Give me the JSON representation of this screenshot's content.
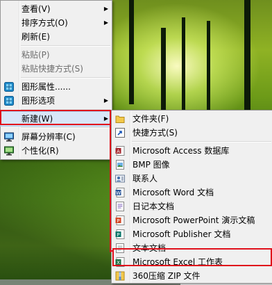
{
  "context_menu": {
    "items": [
      {
        "label": "查看(V)",
        "disabled": false,
        "arrow": "▶"
      },
      {
        "label": "排序方式(O)",
        "disabled": false,
        "arrow": "▶"
      },
      {
        "label": "刷新(E)",
        "disabled": false
      },
      {
        "label": "粘贴(P)",
        "disabled": true
      },
      {
        "label": "粘贴快捷方式(S)",
        "disabled": true
      },
      {
        "label": "图形属性......",
        "icon": "graphics-properties-icon"
      },
      {
        "label": "图形选项",
        "icon": "graphics-options-icon",
        "arrow": "▶"
      },
      {
        "label": "新建(W)",
        "arrow": "▶",
        "highlighted": true
      },
      {
        "label": "屏幕分辨率(C)",
        "icon": "screen-resolution-icon"
      },
      {
        "label": "个性化(R)",
        "icon": "personalize-icon"
      }
    ]
  },
  "new_submenu": {
    "items": [
      {
        "label": "文件夹(F)",
        "icon": "folder-icon"
      },
      {
        "label": "快捷方式(S)",
        "icon": "shortcut-icon"
      },
      {
        "label": "Microsoft Access 数据库",
        "icon": "access-icon"
      },
      {
        "label": "BMP 图像",
        "icon": "bmp-icon"
      },
      {
        "label": "联系人",
        "icon": "contact-icon"
      },
      {
        "label": "Microsoft Word 文档",
        "icon": "word-icon"
      },
      {
        "label": "日记本文档",
        "icon": "journal-icon"
      },
      {
        "label": "Microsoft PowerPoint 演示文稿",
        "icon": "powerpoint-icon"
      },
      {
        "label": "Microsoft Publisher 文档",
        "icon": "publisher-icon"
      },
      {
        "label": "文本文档",
        "icon": "text-document-icon"
      },
      {
        "label": "Microsoft Excel 工作表",
        "icon": "excel-icon"
      },
      {
        "label": "360压缩 ZIP 文件",
        "icon": "zip-icon"
      }
    ]
  },
  "colors": {
    "annotation_red": "#e0101b",
    "menu_background": "#f0f0f0",
    "highlight": "#d8e6f8"
  }
}
